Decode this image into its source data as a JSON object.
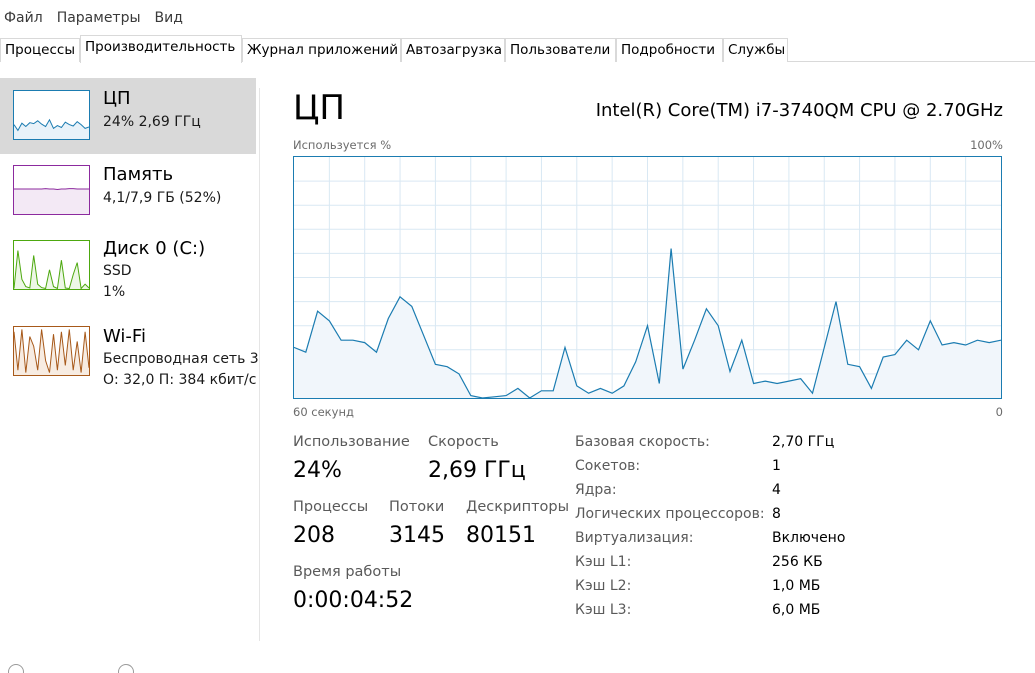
{
  "menu": [
    "Файл",
    "Параметры",
    "Вид"
  ],
  "tabs": [
    "Процессы",
    "Производительность",
    "Журнал приложений",
    "Автозагрузка",
    "Пользователи",
    "Подробности",
    "Службы"
  ],
  "active_tab": "Производительность",
  "sidebar": [
    {
      "title": "ЦП",
      "line1": "24% 2,69 ГГц",
      "line2": "",
      "color": "#1b7cb1",
      "fill": "#e8f2f9",
      "spark": [
        30,
        18,
        33,
        26,
        34,
        32,
        38,
        31,
        26,
        40,
        22,
        28,
        24,
        35,
        30,
        27,
        36,
        30,
        22,
        25
      ]
    },
    {
      "title": "Память",
      "line1": "4,1/7,9 ГБ (52%)",
      "line2": "",
      "color": "#8c2a9e",
      "fill": "#f3e9f5",
      "spark": [
        52,
        52,
        52,
        52,
        52,
        52,
        52,
        52,
        53,
        52,
        52,
        51,
        52,
        52,
        53,
        53,
        52,
        52,
        52,
        52
      ]
    },
    {
      "title": "Диск 0 (C:)",
      "line1": "SSD",
      "line2": "1%",
      "color": "#4da80f",
      "fill": "#edf7e6",
      "spark": [
        1,
        80,
        20,
        5,
        2,
        70,
        10,
        3,
        1,
        40,
        5,
        1,
        60,
        2,
        1,
        30,
        55,
        1,
        10,
        2
      ]
    },
    {
      "title": "Wi-Fi",
      "line1": "Беспроводная сеть 3",
      "line2": "О: 32,0  П: 384 кбит/с",
      "color": "#a7591a",
      "fill": "#f7ece2",
      "spark": [
        90,
        10,
        95,
        5,
        80,
        60,
        10,
        95,
        30,
        5,
        85,
        10,
        90,
        20,
        95,
        10,
        70,
        5,
        90,
        15
      ]
    }
  ],
  "main": {
    "title": "ЦП",
    "cpu_model": "Intel(R) Core(TM) i7-3740QM CPU @ 2.70GHz",
    "graph_label_left": "Используется %",
    "graph_label_right": "100%",
    "graph_bottom_left": "60 секунд",
    "graph_bottom_right": "0",
    "graph_color": "#1b7cb1",
    "graph_fill": "#f1f6fb",
    "graph_grid": "#d9e8f3",
    "stats": {
      "usage_label": "Использование",
      "usage_value": "24%",
      "speed_label": "Скорость",
      "speed_value": "2,69 ГГц",
      "processes_label": "Процессы",
      "processes_value": "208",
      "threads_label": "Потоки",
      "threads_value": "3145",
      "handles_label": "Дескрипторы",
      "handles_value": "80151",
      "uptime_label": "Время работы",
      "uptime_value": "0:00:04:52"
    },
    "info": [
      {
        "label": "Базовая скорость:",
        "value": "2,70 ГГц"
      },
      {
        "label": "Сокетов:",
        "value": "1"
      },
      {
        "label": "Ядра:",
        "value": "4"
      },
      {
        "label": "Логических процессоров:",
        "value": "8"
      },
      {
        "label": "Виртуализация:",
        "value": "Включено"
      },
      {
        "label": "Кэш L1:",
        "value": "256 КБ"
      },
      {
        "label": "Кэш L2:",
        "value": "1,0 МБ"
      },
      {
        "label": "Кэш L3:",
        "value": "6,0 МБ"
      }
    ]
  },
  "chart_data": {
    "type": "area",
    "x": [
      60,
      59,
      58,
      57,
      56,
      55,
      54,
      53,
      52,
      51,
      50,
      49,
      48,
      47,
      46,
      45,
      44,
      43,
      42,
      41,
      40,
      39,
      38,
      37,
      36,
      35,
      34,
      33,
      32,
      31,
      30,
      29,
      28,
      27,
      26,
      25,
      24,
      23,
      22,
      21,
      20,
      19,
      18,
      17,
      16,
      15,
      14,
      13,
      12,
      11,
      10,
      9,
      8,
      7,
      6,
      5,
      4,
      3,
      2,
      1,
      0
    ],
    "values": [
      21,
      19,
      36,
      32,
      24,
      24,
      23,
      19,
      33,
      42,
      38,
      26,
      14,
      13,
      10,
      1,
      0,
      0.5,
      1,
      4,
      0,
      3,
      3,
      21,
      5,
      2,
      4,
      2,
      5,
      15,
      30,
      6,
      62,
      12,
      24,
      37,
      30,
      11,
      24,
      6,
      7,
      6,
      7,
      8,
      2,
      21,
      40,
      14,
      13,
      4,
      17,
      18,
      24,
      20,
      32,
      22,
      23,
      22,
      24,
      23,
      24
    ],
    "ylim": [
      0,
      100
    ],
    "xlim": [
      60,
      0
    ],
    "ylabel": "Используется %",
    "grid": true
  }
}
